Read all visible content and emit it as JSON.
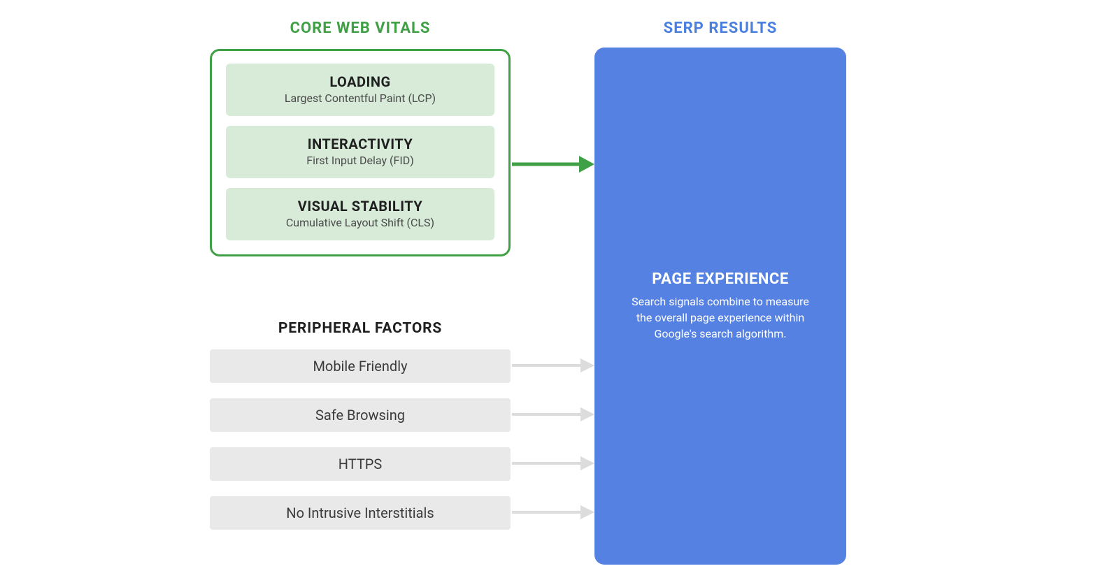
{
  "titles": {
    "cwv": "CORE WEB VITALS",
    "serp": "SERP RESULTS"
  },
  "cwv_items": [
    {
      "title": "LOADING",
      "sub": "Largest Contentful Paint (LCP)"
    },
    {
      "title": "INTERACTIVITY",
      "sub": "First Input Delay (FID)"
    },
    {
      "title": "VISUAL STABILITY",
      "sub": "Cumulative Layout Shift (CLS)"
    }
  ],
  "peripheral": {
    "title": "PERIPHERAL FACTORS",
    "items": [
      "Mobile Friendly",
      "Safe Browsing",
      "HTTPS",
      "No Intrusive Interstitials"
    ]
  },
  "serp_panel": {
    "heading": "PAGE EXPERIENCE",
    "desc": "Search signals combine to measure the overall page experience within Google's search algorithm."
  },
  "colors": {
    "green": "#3fa045",
    "green_tint": "#d7ebd8",
    "blue": "#5581e2",
    "blue_text": "#4a7fe0",
    "gray_box": "#e9e9e9",
    "gray_arrow": "#dcdcdc"
  }
}
